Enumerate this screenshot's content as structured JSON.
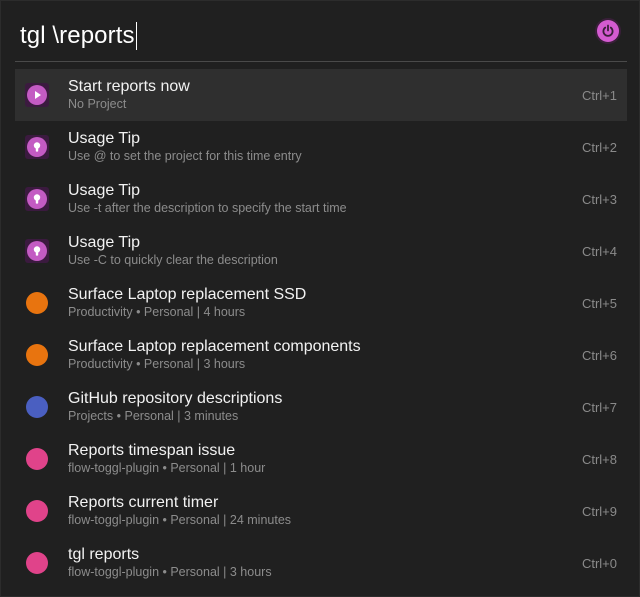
{
  "search": {
    "query": "tgl \\reports"
  },
  "colors": {
    "accent_purple": "#c35bc3",
    "orange": "#e8740f",
    "blue": "#4a5fc1",
    "pink": "#e0438a"
  },
  "results": [
    {
      "title": "Start reports now",
      "subtitle": "No Project",
      "shortcut": "Ctrl+1",
      "icon": "play-icon",
      "selected": true
    },
    {
      "title": "Usage Tip",
      "subtitle": "Use @ to set the project for this time entry",
      "shortcut": "Ctrl+2",
      "icon": "tip-icon"
    },
    {
      "title": "Usage Tip",
      "subtitle": "Use -t after the description to specify the start time",
      "shortcut": "Ctrl+3",
      "icon": "tip-icon"
    },
    {
      "title": "Usage Tip",
      "subtitle": "Use -C to quickly clear the description",
      "shortcut": "Ctrl+4",
      "icon": "tip-icon"
    },
    {
      "title": "Surface Laptop replacement SSD",
      "subtitle": "Productivity • Personal | 4 hours",
      "shortcut": "Ctrl+5",
      "icon": "project-dot-icon",
      "color": "#e8740f"
    },
    {
      "title": "Surface Laptop replacement components",
      "subtitle": "Productivity • Personal | 3 hours",
      "shortcut": "Ctrl+6",
      "icon": "project-dot-icon",
      "color": "#e8740f"
    },
    {
      "title": "GitHub repository descriptions",
      "subtitle": "Projects • Personal | 3 minutes",
      "shortcut": "Ctrl+7",
      "icon": "project-dot-icon",
      "color": "#4a5fc1"
    },
    {
      "title": "Reports timespan issue",
      "subtitle": "flow-toggl-plugin • Personal | 1 hour",
      "shortcut": "Ctrl+8",
      "icon": "project-dot-icon",
      "color": "#e0438a"
    },
    {
      "title": "Reports current timer",
      "subtitle": "flow-toggl-plugin • Personal | 24 minutes",
      "shortcut": "Ctrl+9",
      "icon": "project-dot-icon",
      "color": "#e0438a"
    },
    {
      "title": "tgl reports",
      "subtitle": "flow-toggl-plugin • Personal | 3 hours",
      "shortcut": "Ctrl+0",
      "icon": "project-dot-icon",
      "color": "#e0438a"
    }
  ]
}
